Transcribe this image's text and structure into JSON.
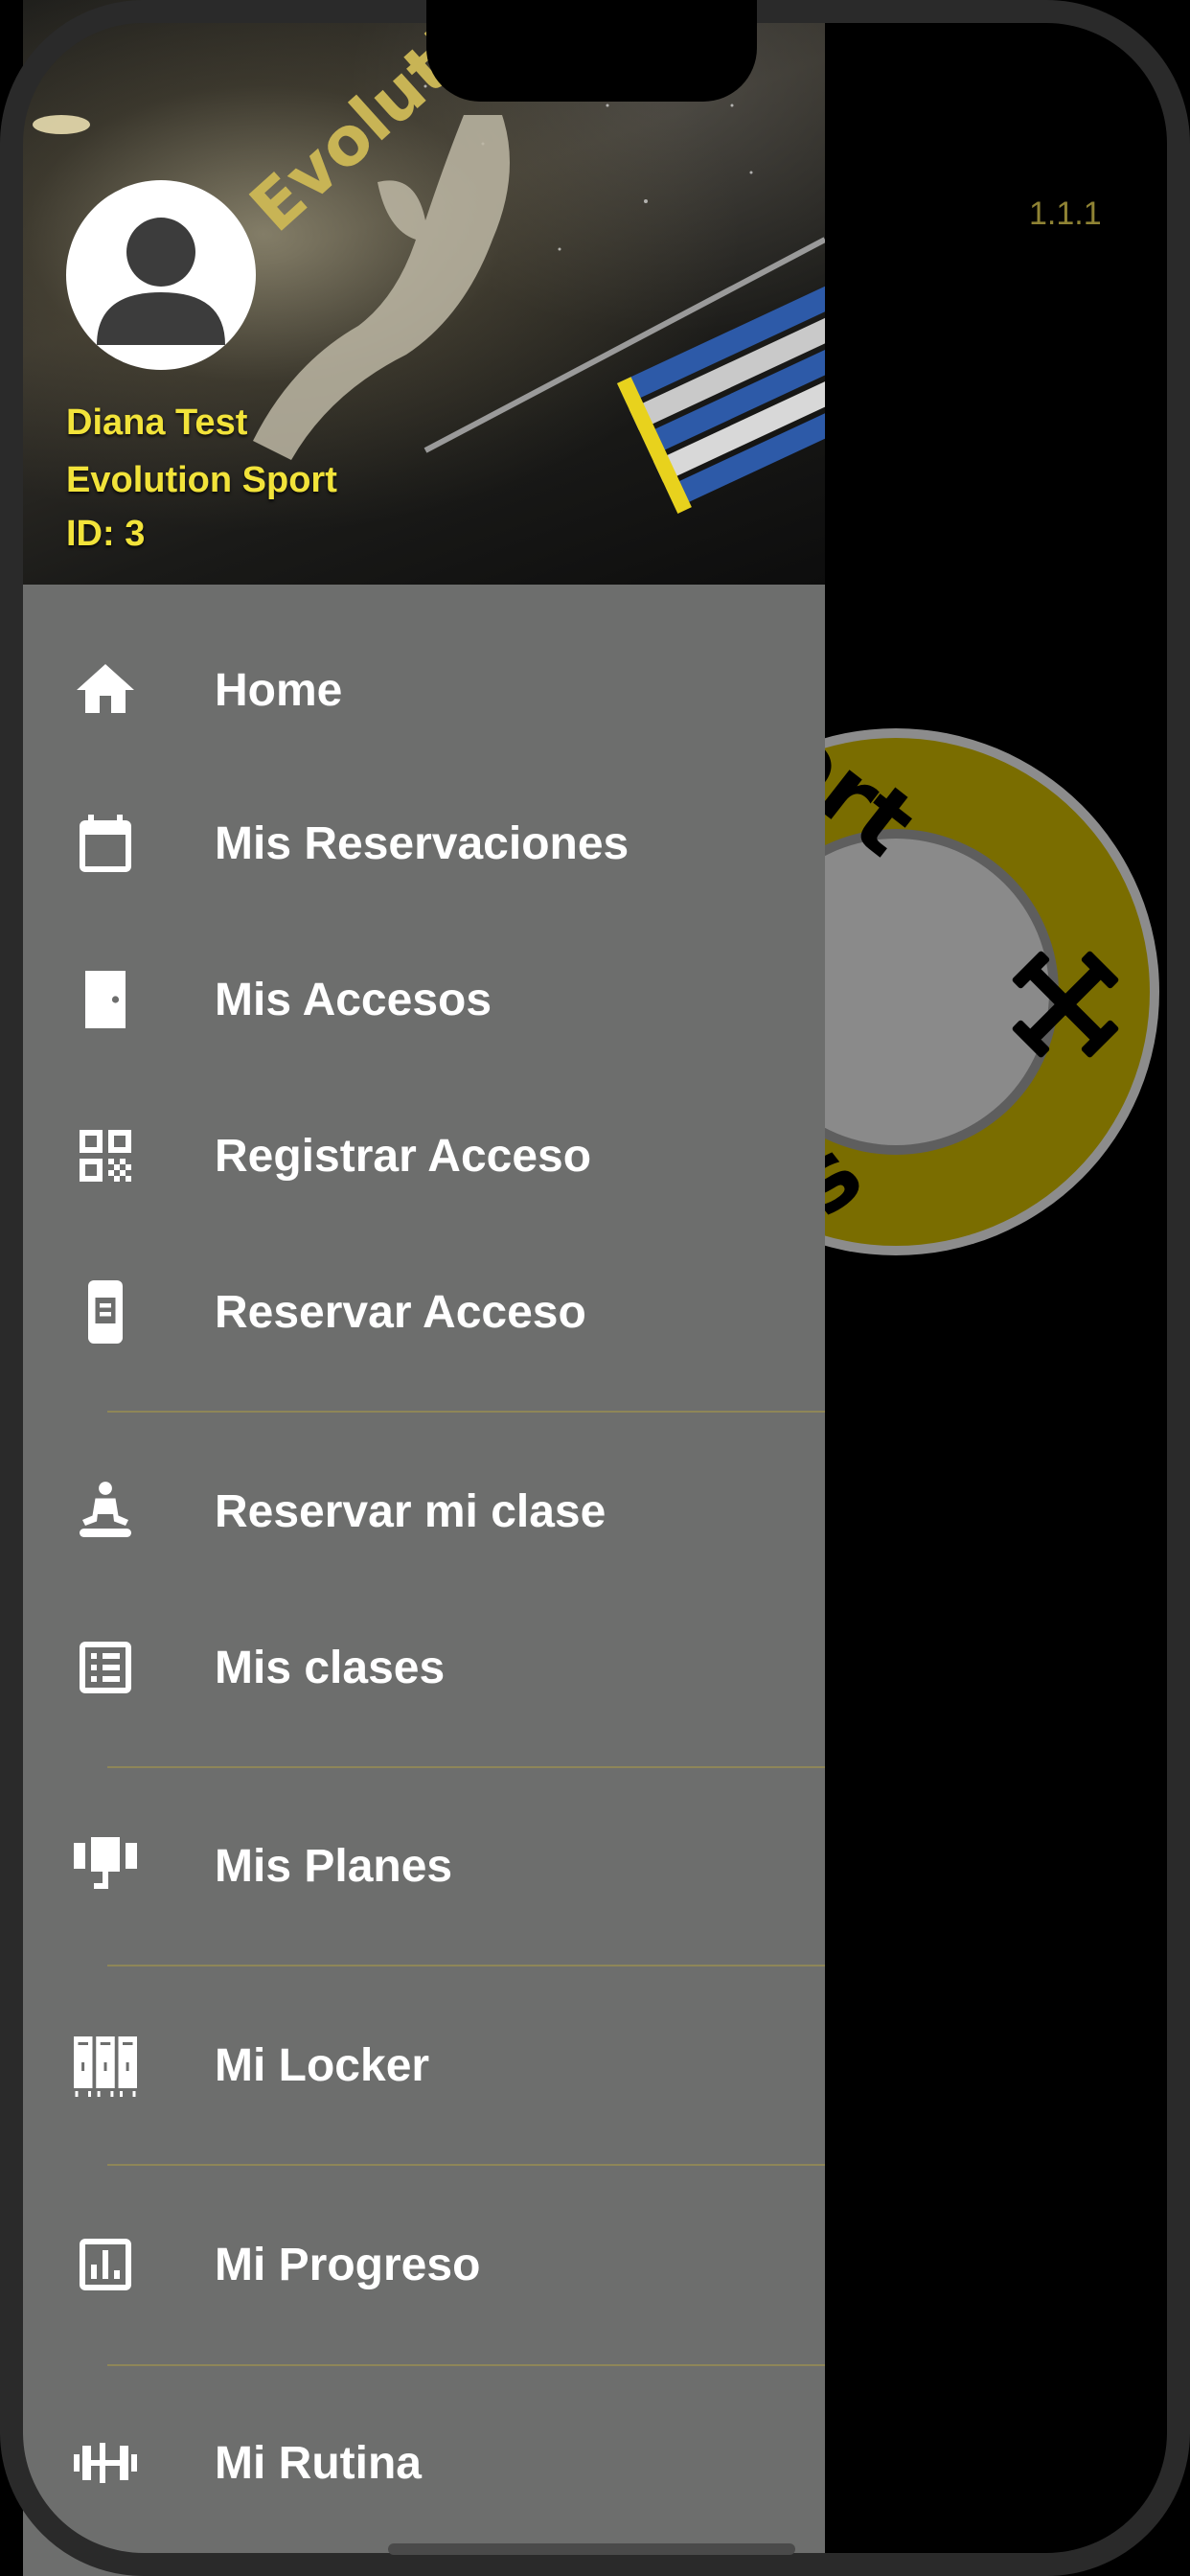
{
  "app": {
    "version": "1.1.1",
    "logo_text_top": "port",
    "logo_text_bottom": "ess"
  },
  "drawer": {
    "header_brand_text": "Evolution",
    "user": {
      "name": "Diana Test",
      "company": "Evolution Sport",
      "id": "ID: 3"
    },
    "items": [
      {
        "label": "Home",
        "icon": "home-icon"
      },
      {
        "label": "Mis Reservaciones",
        "icon": "calendar-icon"
      },
      {
        "label": "Mis Accesos",
        "icon": "door-icon"
      },
      {
        "label": "Registrar Acceso",
        "icon": "qr-code-icon"
      },
      {
        "label": "Reservar Acceso",
        "icon": "phone-card-icon"
      },
      {
        "label": "Reservar mi clase",
        "icon": "meditation-icon"
      },
      {
        "label": "Mis clases",
        "icon": "list-icon"
      },
      {
        "label": "Mis Planes",
        "icon": "gym-plan-icon"
      },
      {
        "label": "Mi Locker",
        "icon": "locker-icon"
      },
      {
        "label": "Mi Progreso",
        "icon": "chart-icon"
      },
      {
        "label": "Mi Rutina",
        "icon": "dumbbell-icon"
      }
    ]
  },
  "colors": {
    "accent_yellow": "#f2e33a",
    "drawer_bg": "#6d6e6d",
    "logo_ring": "#7a6d00",
    "divider": "#8e8658"
  }
}
